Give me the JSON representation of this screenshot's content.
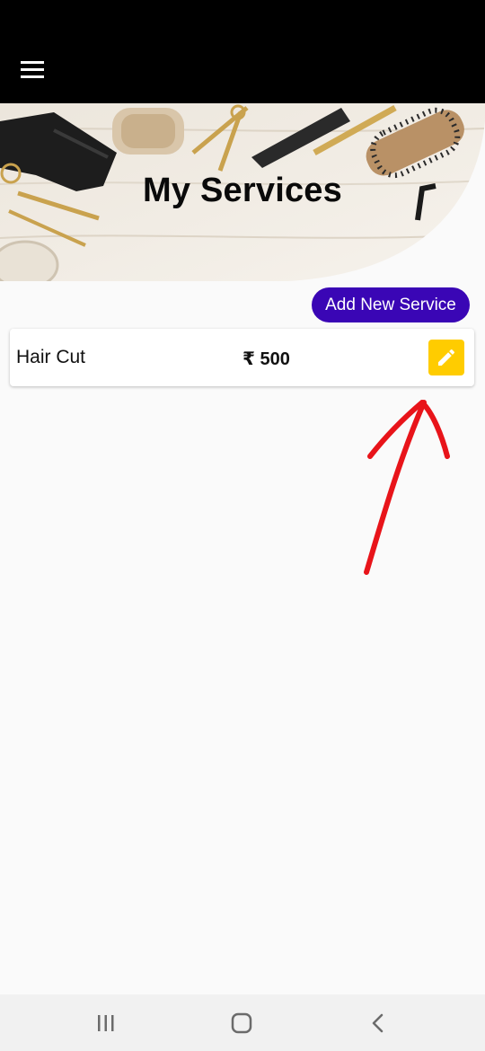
{
  "header": {
    "menu_icon": "hamburger-menu-icon"
  },
  "banner": {
    "title": "My Services",
    "image": "hair-salon-tools-photo"
  },
  "actions": {
    "add_service_label": "Add New Service"
  },
  "services": [
    {
      "name": "Hair Cut",
      "price": "₹ 500",
      "edit_icon": "pencil-icon"
    }
  ],
  "system_nav": {
    "recents_icon": "recents-icon",
    "home_icon": "home-icon",
    "back_icon": "back-icon"
  },
  "colors": {
    "topbar": "#000000",
    "accent": "#3a06b5",
    "edit_button": "#ffcc00",
    "annotation": "#e8141a",
    "background": "#fafafa"
  }
}
